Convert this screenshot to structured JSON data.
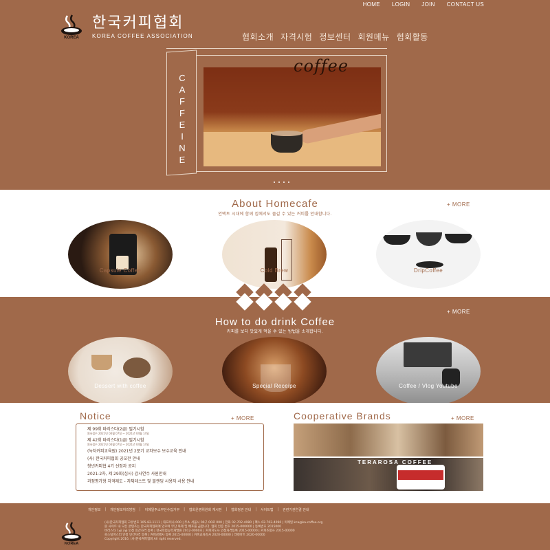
{
  "header": {
    "topnav": [
      "HOME",
      "LOGIN",
      "JOIN",
      "CONTACT US"
    ],
    "logo_ko": "한국커피협회",
    "logo_en": "KOREA COFFEE ASSOCIATION",
    "logo_emblem_text": "KOREA",
    "mainnav": [
      "협회소개",
      "자격시험",
      "정보센터",
      "회원메뉴",
      "협회활동"
    ]
  },
  "hero": {
    "spine_text": "CAFFEINE",
    "photo_word": "coffee",
    "slide_count": 4
  },
  "about": {
    "title": "About Homecafe",
    "subtitle": "언택트 시대에 함께 집에서도 즐길 수 있는 커피를 안내합니다.",
    "more": "+ MORE",
    "items": [
      "Capsule Coffee",
      "Cold Brew",
      "DripCoffee"
    ]
  },
  "drink": {
    "title": "How to do drink Coffee",
    "subtitle": "커피를 보다 맛있게 먹을 수 있는 방법을 소개합니다.",
    "more": "+ MORE",
    "items": [
      "Dessert with coffee",
      "Special Receipe",
      "Coffee / Vlog Youtube"
    ]
  },
  "notice": {
    "title": "Notice",
    "more": "+ MORE",
    "items": [
      {
        "text": "제 99회 바리스타(2급) 필기시험",
        "date": "원서접수 2021년 04월 07일 ~ 2021년 04월 14일"
      },
      {
        "text": "제 42회 바리스타(1급) 필기시험",
        "date": "원서접수 2021년 04월 07일 ~ 2021년 04월 14일"
      },
      {
        "text": "(녹차커피교육원) 2021년 2분기 교차보수 보수교육 안내",
        "date": ""
      },
      {
        "text": "(사) 한국커피협회 공모전 안내",
        "date": ""
      },
      {
        "text": "청년커피협 4기 선정자 공지",
        "date": ""
      },
      {
        "text": "2021-2차, 제 29회(심사) 감사연수 사원안내",
        "date": ""
      },
      {
        "text": "과정평가형 자격제도 - 자체테스트 및 블랜딩 사용자 사용 안내",
        "date": ""
      }
    ]
  },
  "brands": {
    "title": "Cooperative Brands",
    "more": "+ MORE",
    "brand_label": "TERAROSA COFFEE"
  },
  "footer": {
    "links": [
      "개인정보",
      "개인정보처리방침",
      "이메일주소무단수집거부",
      "협회운영위원회 게시판",
      "협회정관 안내",
      "사이트맵",
      "관련기관연결 안내"
    ],
    "info": [
      "(사)한국커피협회 고유번호 105-82-1111 | 대표이사 000 | 주소 서울시 00구 00로 000 | 전화 02-702-4080 | 팩스 02-702-4090 | 이메일 kca@ka-coffee.org",
      "본 사이트 내 모든 콘텐츠는 한국커피협회에 있으며 무단 복제 및 배포를 금합니다. 협회 인증 번호 2015-000000 | 등록번호 2015000",
      "바리스타 1급 2급 인정 민간자격 등록 | 한국직업능력개발원 2012-0000호 | 커피지도사 인정자격등록 2015-00000 | 커피조향사 2015-00000",
      "로스팅마스터 인정 민간자격 등록 | 커피감별사 등록 2015-00000 | 커피교육강사 2020-00000 | 라떼아트 2020-00000",
      "Copyright 2016. (사)한국커피협회 All right reserved."
    ]
  }
}
